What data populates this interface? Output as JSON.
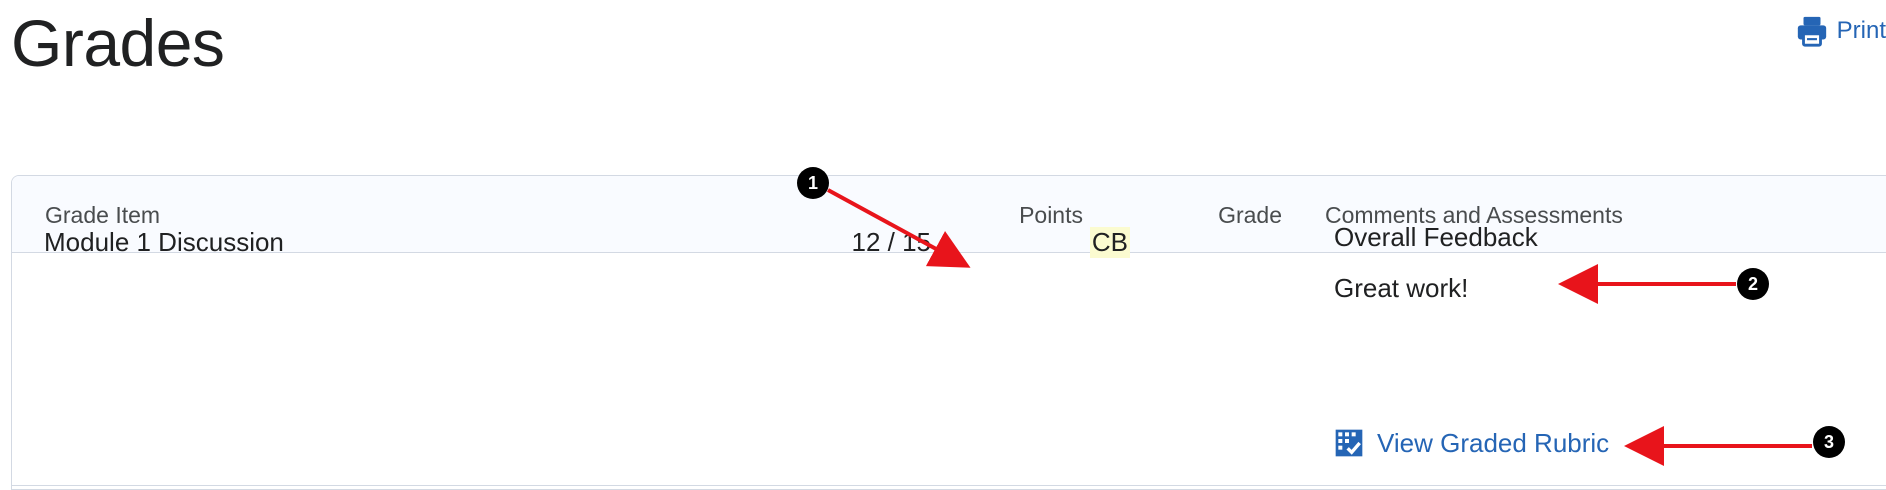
{
  "page": {
    "title": "Grades",
    "print_label": "Print"
  },
  "table": {
    "columns": {
      "item": "Grade Item",
      "points": "Points",
      "grade": "Grade",
      "comments": "Comments and Assessments"
    },
    "rows": [
      {
        "item": "Module 1 Discussion",
        "points": "12 / 15",
        "grade": "CB",
        "feedback_heading": "Overall Feedback",
        "feedback_text": "Great work!",
        "rubric_link": "View Graded Rubric"
      }
    ]
  },
  "callouts": [
    "1",
    "2",
    "3"
  ],
  "icons": {
    "print": "printer-icon",
    "rubric": "rubric-icon"
  },
  "colors": {
    "link": "#2565b5",
    "grade_highlight": "#fbfbd0",
    "callout_arrow": "#e8141b",
    "callout_badge": "#000000"
  }
}
